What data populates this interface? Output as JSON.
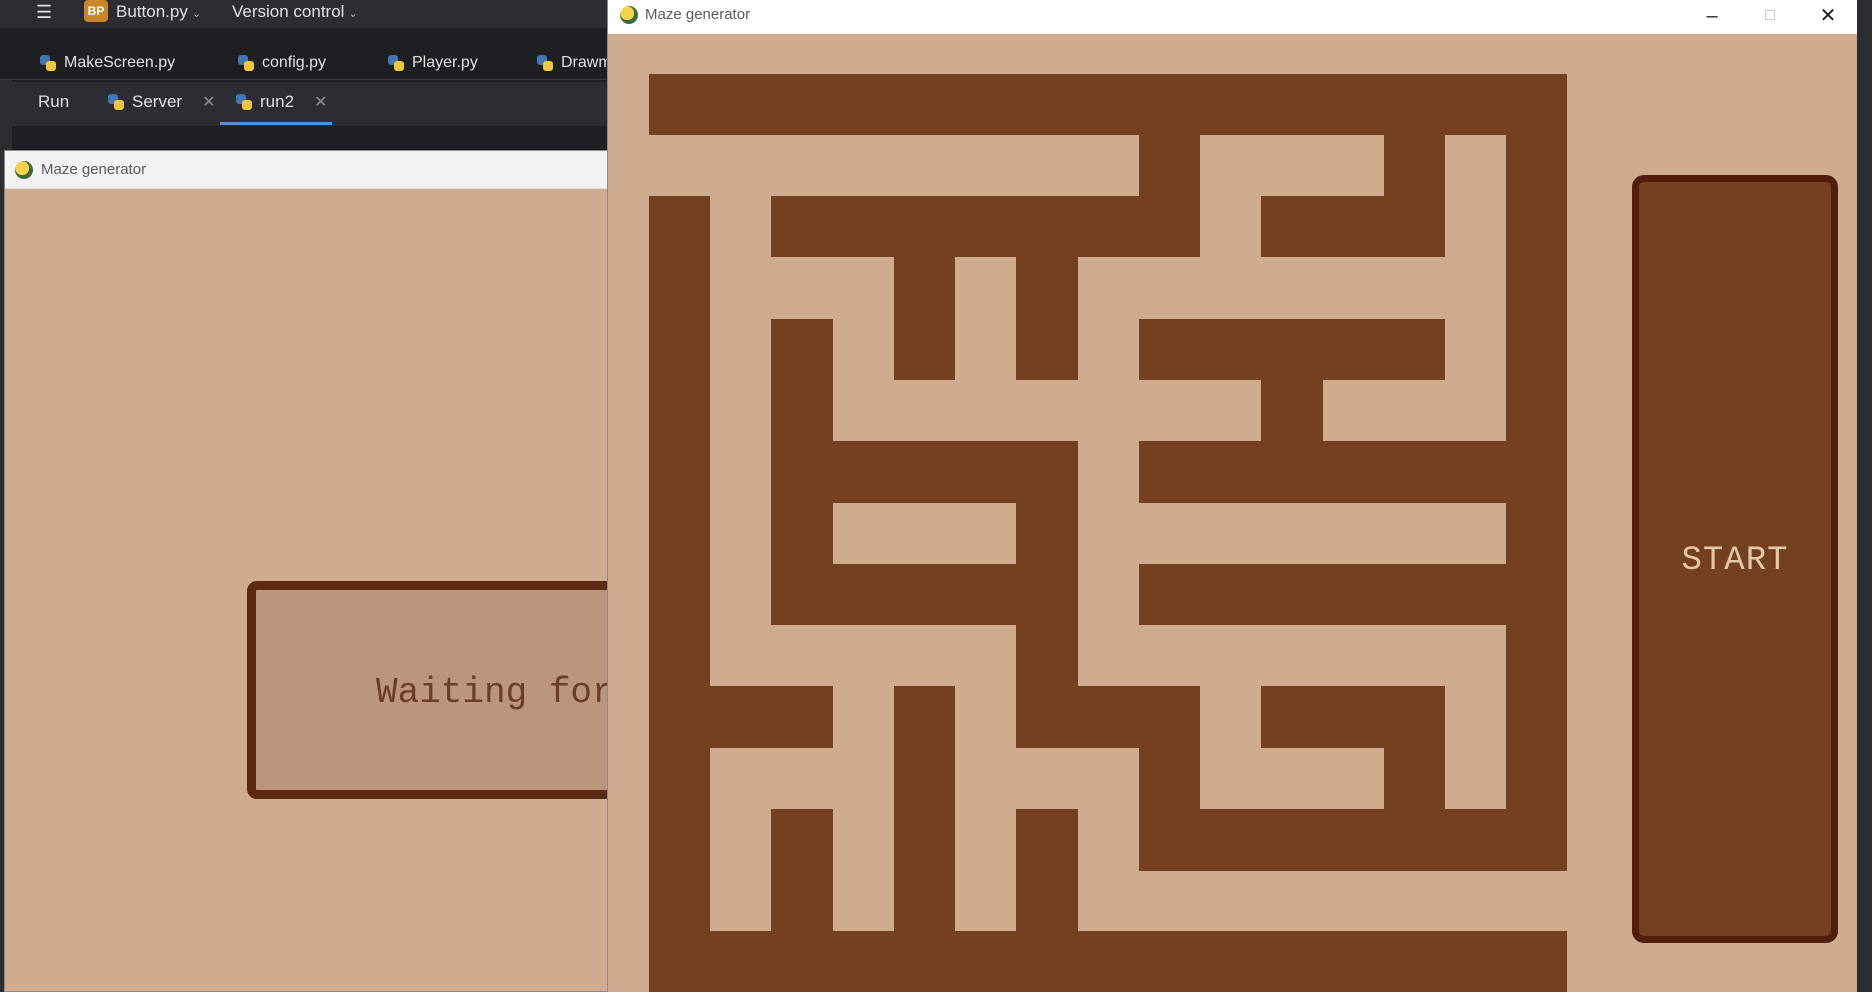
{
  "ide": {
    "project_badge": "BP",
    "project_name": "Button.py",
    "version_control": "Version control",
    "editor_tabs": [
      "MakeScreen.py",
      "config.py",
      "Player.py",
      "Drawm"
    ],
    "run_label": "Run",
    "run_tabs": [
      "Server",
      "run2"
    ]
  },
  "back_window": {
    "title": "Maze generator",
    "waiting_text": "Waiting for"
  },
  "front_window": {
    "title": "Maze generator",
    "controls": {
      "minimize": "–",
      "maximize": "□",
      "close": "✕"
    },
    "start_label": "START"
  },
  "colors": {
    "background": "#cfab8f",
    "wall": "#734021",
    "button_border": "#521e0c",
    "start_text": "#e4c8ad"
  },
  "icons": [
    "menu-icon",
    "python-icon",
    "pygame-icon",
    "minimize-icon",
    "maximize-icon",
    "close-icon"
  ]
}
